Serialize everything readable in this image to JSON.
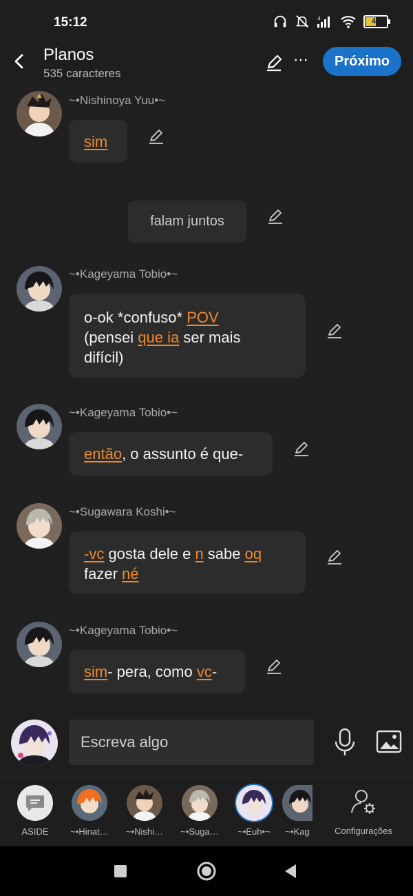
{
  "status": {
    "time": "15:12",
    "battery": "47",
    "battery_level": 0.47
  },
  "header": {
    "title": "Planos",
    "subtitle": "535 caracteres",
    "next_label": "Próximo"
  },
  "messages": [
    {
      "sender": "~•Nishinoya Yuu•~",
      "parts": [
        {
          "t": "sim",
          "hl": true
        }
      ]
    },
    {
      "narration": "falam juntos"
    },
    {
      "sender": "~•Kageyama Tobio•~",
      "lines": [
        [
          {
            "t": "o-ok *confuso* "
          },
          {
            "t": "POV",
            "hl": true
          }
        ],
        [
          {
            "t": "(pensei "
          },
          {
            "t": "que ia",
            "hl": true
          },
          {
            "t": " ser mais"
          }
        ],
        [
          {
            "t": "difícil)"
          }
        ]
      ]
    },
    {
      "sender": "~•Kageyama Tobio•~",
      "parts": [
        {
          "t": "então",
          "hl": true
        },
        {
          "t": ", o assunto é que-"
        }
      ]
    },
    {
      "sender": "~•Sugawara Koshi•~",
      "lines": [
        [
          {
            "t": "-vc",
            "hl": true
          },
          {
            "t": " gosta dele e "
          },
          {
            "t": "n",
            "hl": true
          },
          {
            "t": " sabe "
          },
          {
            "t": "oq",
            "hl": true
          }
        ],
        [
          {
            "t": "fazer "
          },
          {
            "t": "né",
            "hl": true
          }
        ]
      ]
    },
    {
      "sender": "~•Kageyama Tobio•~",
      "parts": [
        {
          "t": "sim",
          "hl": true
        },
        {
          "t": "- pera, como "
        },
        {
          "t": "vc",
          "hl": true
        },
        {
          "t": "-"
        }
      ]
    }
  ],
  "composer": {
    "placeholder": "Escreva algo"
  },
  "characters": [
    {
      "label": "ASIDE"
    },
    {
      "label": "~•Hinat…"
    },
    {
      "label": "~•Nishi…"
    },
    {
      "label": "~•Suga…"
    },
    {
      "label": "~•Euh•~"
    },
    {
      "label": "~•Kag"
    }
  ],
  "settings_label": "Configurações",
  "colors": {
    "accent": "#1a73c9",
    "highlight": "#f08a2c",
    "bubble": "#2c2c2c",
    "background": "#202020"
  }
}
